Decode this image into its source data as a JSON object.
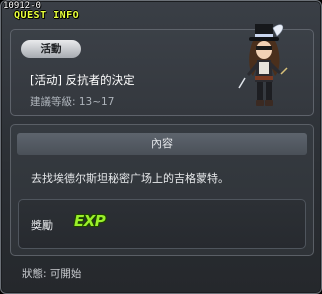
{
  "window": {
    "quest_id": "10912-0",
    "title": "QUEST INFO"
  },
  "quest": {
    "category": "活動",
    "name": "[活动] 反抗者的決定",
    "level": "建議等級: 13~17"
  },
  "content": {
    "header": "內容",
    "description": "去找埃德尔斯坦秘密广场上的吉格蒙特。"
  },
  "reward": {
    "label": "獎勵",
    "exp_text": "EXP",
    "icon": "exp-icon"
  },
  "status": {
    "label": "狀態:",
    "value": "可開始"
  },
  "colors": {
    "title": "#e8ff3a",
    "exp": "#9af02a",
    "panel": "#3b4047"
  }
}
